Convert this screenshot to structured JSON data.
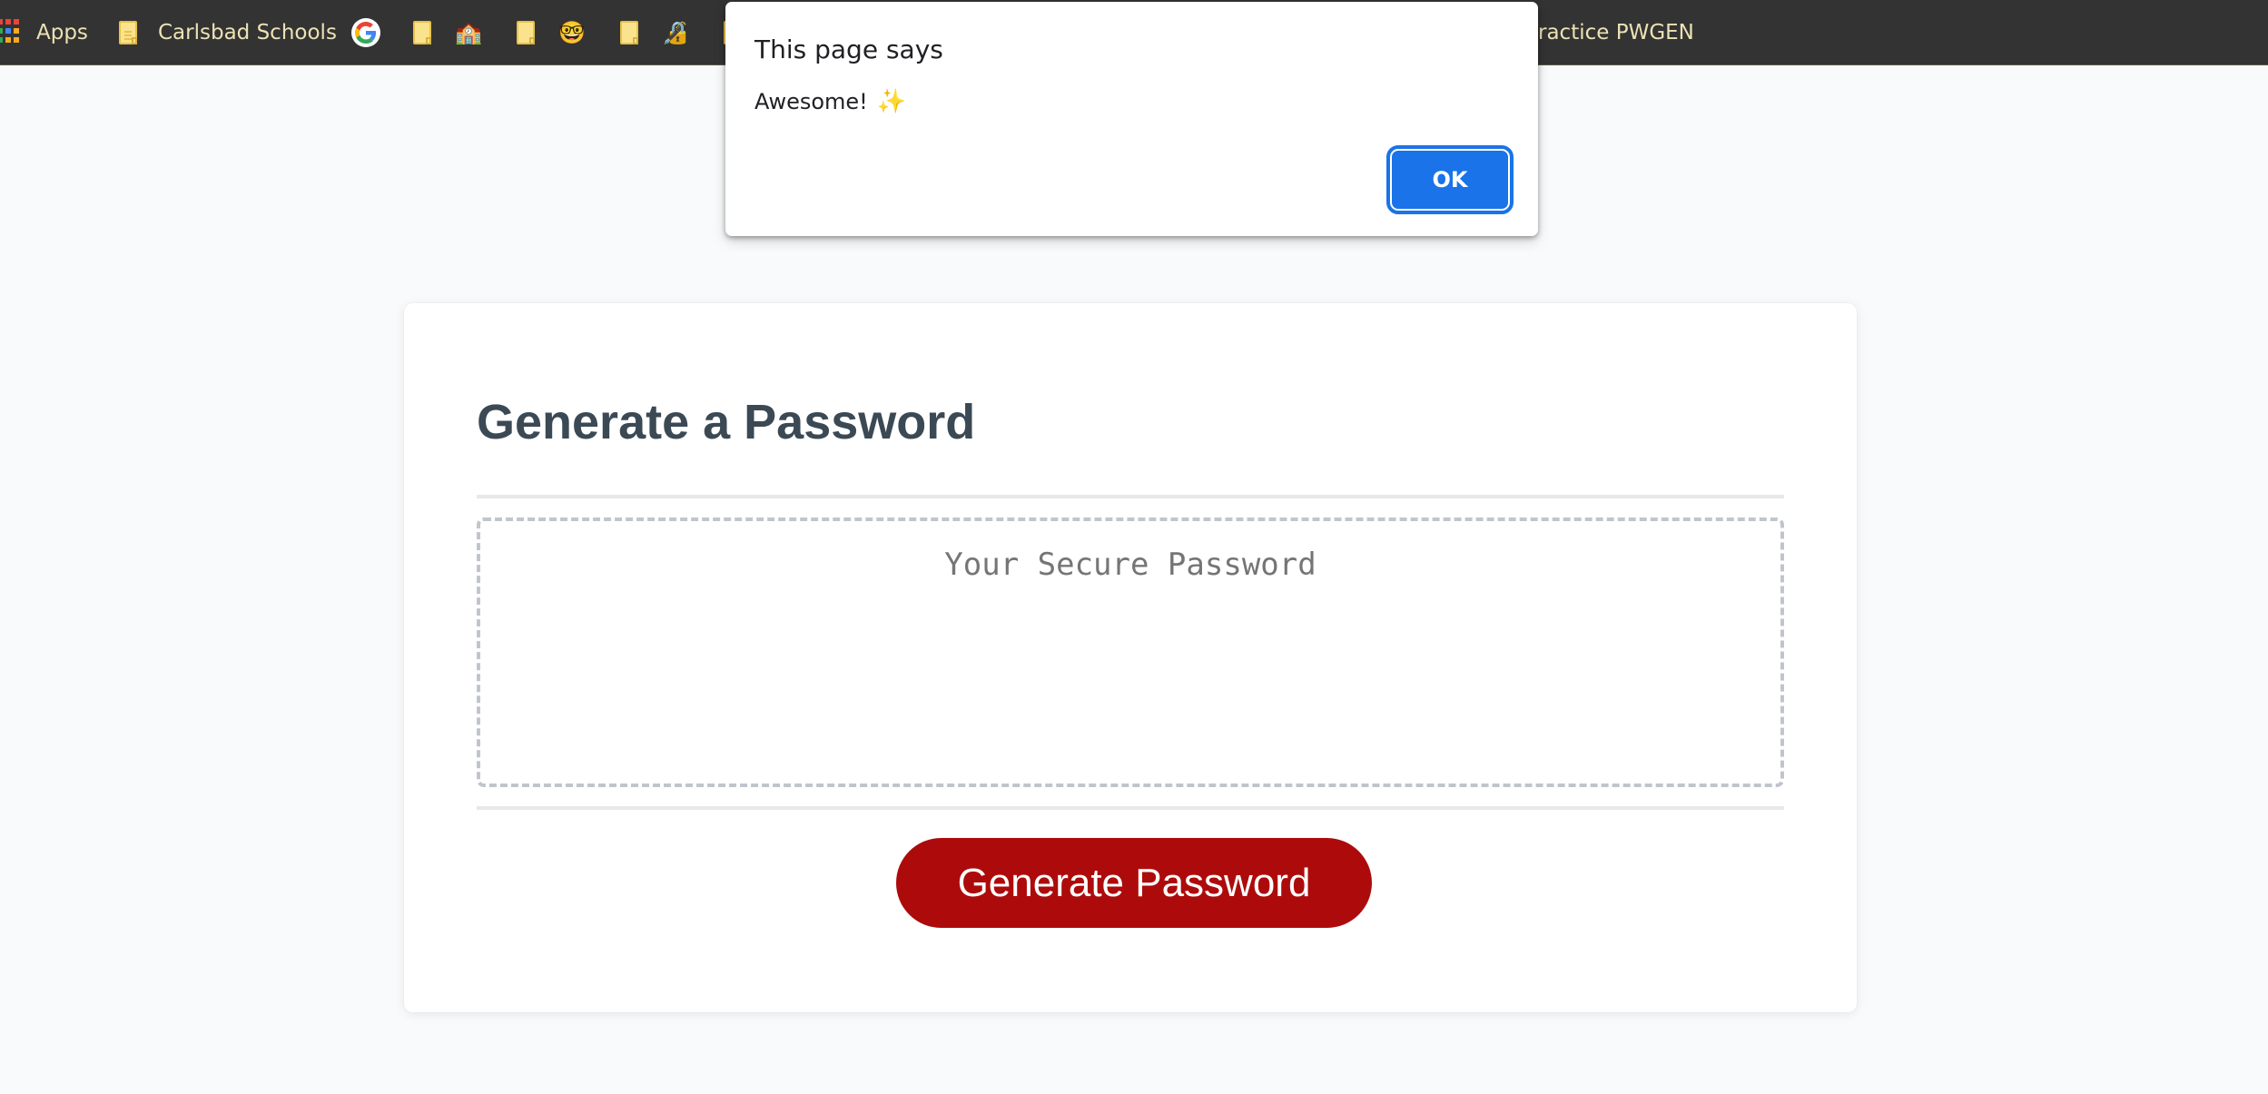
{
  "bookmarks_bar": {
    "items": [
      {
        "label": "Apps",
        "icon": "apps-grid-icon"
      },
      {
        "label": "Carlsbad Schools",
        "icon": "folder-icon"
      },
      {
        "label": "",
        "icon": "google-icon"
      },
      {
        "label": "",
        "icon": "folder-icon"
      },
      {
        "label": "",
        "icon": "school-icon",
        "glyph": "🏫"
      },
      {
        "label": "",
        "icon": "folder-icon"
      },
      {
        "label": "",
        "icon": "nerd-face-icon",
        "glyph": "🤓"
      },
      {
        "label": "",
        "icon": "folder-icon"
      },
      {
        "label": "",
        "icon": "locked-with-pen-icon",
        "glyph": "🔏"
      },
      {
        "label": "ractice PWGEN",
        "icon": ""
      }
    ]
  },
  "card": {
    "title": "Generate a Password",
    "password_field": {
      "placeholder": "Your Secure Password",
      "value": ""
    },
    "generate_button_label": "Generate Password",
    "accent_color": "#ad0b0b"
  },
  "dialog": {
    "title": "This page says",
    "message": "Awesome!",
    "message_icon": "✨",
    "ok_label": "OK",
    "button_color": "#1a73e8"
  }
}
